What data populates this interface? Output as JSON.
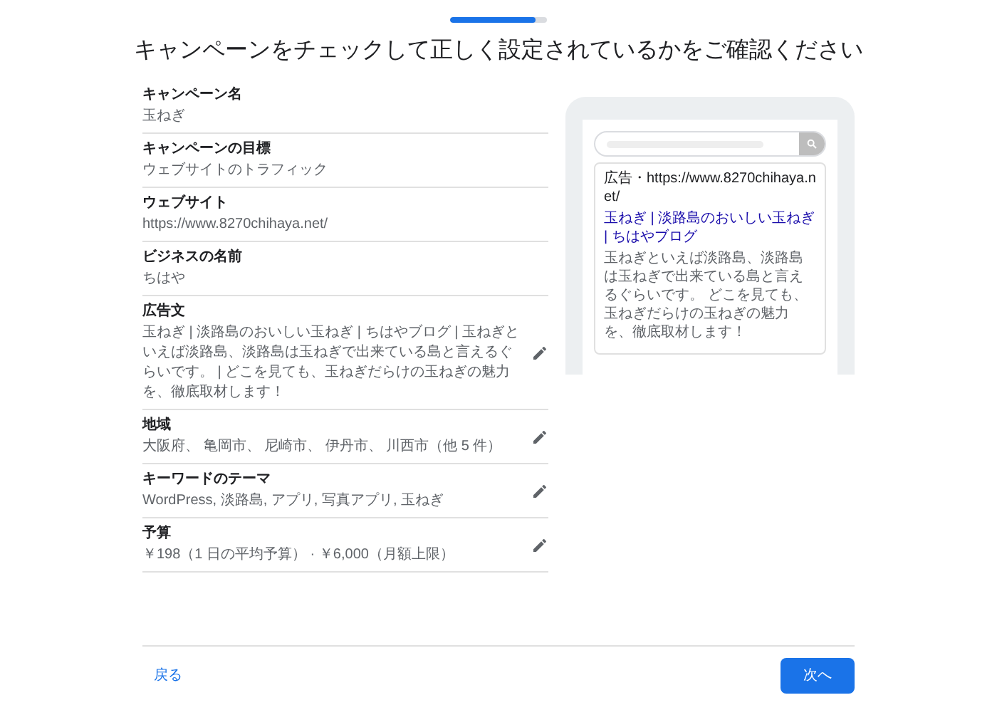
{
  "progress": {
    "level": 0.88
  },
  "title": "キャンペーンをチェックして正しく設定されているかをご確認ください",
  "summary": [
    {
      "label": "キャンペーン名",
      "value": "玉ねぎ",
      "editable": false
    },
    {
      "label": "キャンペーンの目標",
      "value": "ウェブサイトのトラフィック",
      "editable": false
    },
    {
      "label": "ウェブサイト",
      "value": "https://www.8270chihaya.net/",
      "editable": false
    },
    {
      "label": "ビジネスの名前",
      "value": "ちはや",
      "editable": false
    },
    {
      "label": "広告文",
      "value": "玉ねぎ | 淡路島のおいしい玉ねぎ | ちはやブログ | 玉ねぎといえば淡路島、淡路島は玉ねぎで出来ている島と言えるぐらいです。 | どこを見ても、玉ねぎだらけの玉ねぎの魅力を、徹底取材します！",
      "editable": true
    },
    {
      "label": "地域",
      "value": "大阪府、 亀岡市、 尼崎市、 伊丹市、 川西市（他 5 件）",
      "editable": true
    },
    {
      "label": "キーワードのテーマ",
      "value": "WordPress, 淡路島, アプリ, 写真アプリ, 玉ねぎ",
      "editable": true
    },
    {
      "label": "予算",
      "value": "￥198（1 日の平均予算） · ￥6,000（月額上限）",
      "editable": true
    }
  ],
  "preview": {
    "ad_line": "広告・https://www.8270chihaya.net/",
    "headline": "玉ねぎ | 淡路島のおいしい玉ねぎ | ちはやブログ",
    "description": "玉ねぎといえば淡路島、淡路島は玉ねぎで出来ている島と言えるぐらいです。 どこを見ても、玉ねぎだらけの玉ねぎの魅力を、徹底取材します！"
  },
  "footer": {
    "back": "戻る",
    "next": "次へ"
  }
}
